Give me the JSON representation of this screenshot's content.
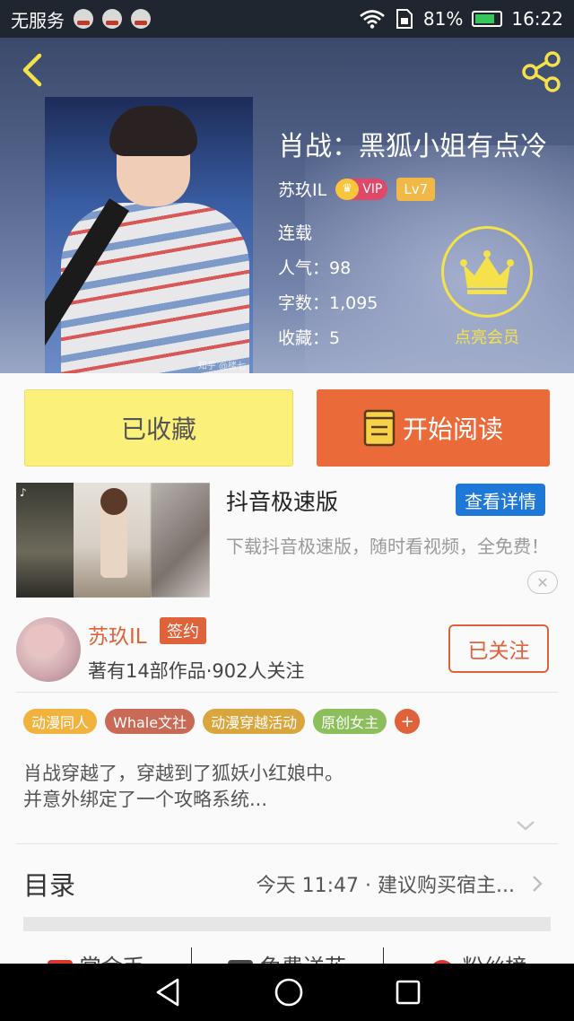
{
  "status_bar": {
    "carrier": "无服务",
    "battery_percent": "81%",
    "battery_level": 0.81,
    "time": "16:22"
  },
  "hero": {
    "title": "肖战：黑狐小姐有点冷",
    "author": "苏玖IL",
    "vip_label": "VIP",
    "level": "Lv7",
    "status": "连载",
    "popularity": "人气：98",
    "word_count": "字数：1,095",
    "favorites": "收藏：5",
    "vip_cta": "点亮会员",
    "cover_watermark": "知乎 @楼七"
  },
  "actions": {
    "favorited_label": "已收藏",
    "read_label": "开始阅读"
  },
  "ad": {
    "title": "抖音极速版",
    "detail_button": "查看详情",
    "description": "下载抖音极速版，随时看视频，全免费！",
    "close": "✕"
  },
  "author_card": {
    "name": "苏玖IL",
    "badge": "签约",
    "stats": "著有14部作品·902人关注",
    "follow_label": "已关注"
  },
  "tags": [
    {
      "label": "动漫同人",
      "color": "#f1b23e"
    },
    {
      "label": "Whale文社",
      "color": "#c96a56"
    },
    {
      "label": "动漫穿越活动",
      "color": "#d8a63c"
    },
    {
      "label": "原创女主",
      "color": "#8cbf5c"
    }
  ],
  "tag_add": "+",
  "synopsis": {
    "line1": "肖战穿越了，穿越到了狐妖小红娘中。",
    "line2": "并意外绑定了一个攻略系统..."
  },
  "toc": {
    "label": "目录",
    "latest": "今天 11:47 · 建议购买宿主..."
  },
  "bottom_tabs": [
    {
      "label": "赏金币",
      "color": "#d9362c"
    },
    {
      "label": "免费送花",
      "color": "#444444"
    },
    {
      "label": "粉丝榜",
      "color": "#d9362c"
    }
  ],
  "colors": {
    "accent": "#e0623a",
    "vip_gold": "#f5e24a",
    "read_button": "#ea6a3a",
    "favorite_button": "#fbf07a"
  }
}
